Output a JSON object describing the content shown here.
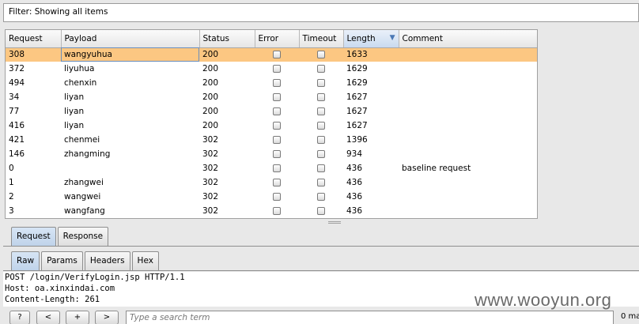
{
  "filter": {
    "label": "Filter:",
    "text": "Showing all items"
  },
  "table": {
    "columns": [
      "Request",
      "Payload",
      "Status",
      "Error",
      "Timeout",
      "Length",
      "Comment"
    ],
    "sorted_column": "Length",
    "sort_indicator": "▼",
    "rows": [
      {
        "request": "308",
        "payload": "wangyuhua",
        "status": "200",
        "error": false,
        "timeout": false,
        "length": "1633",
        "comment": ""
      },
      {
        "request": "372",
        "payload": "liyuhua",
        "status": "200",
        "error": false,
        "timeout": false,
        "length": "1629",
        "comment": ""
      },
      {
        "request": "494",
        "payload": "chenxin",
        "status": "200",
        "error": false,
        "timeout": false,
        "length": "1629",
        "comment": ""
      },
      {
        "request": "34",
        "payload": "liyan",
        "status": "200",
        "error": false,
        "timeout": false,
        "length": "1627",
        "comment": ""
      },
      {
        "request": "77",
        "payload": "liyan",
        "status": "200",
        "error": false,
        "timeout": false,
        "length": "1627",
        "comment": ""
      },
      {
        "request": "416",
        "payload": "liyan",
        "status": "200",
        "error": false,
        "timeout": false,
        "length": "1627",
        "comment": ""
      },
      {
        "request": "421",
        "payload": "chenmei",
        "status": "302",
        "error": false,
        "timeout": false,
        "length": "1396",
        "comment": ""
      },
      {
        "request": "146",
        "payload": "zhangming",
        "status": "302",
        "error": false,
        "timeout": false,
        "length": "934",
        "comment": ""
      },
      {
        "request": "0",
        "payload": "",
        "status": "302",
        "error": false,
        "timeout": false,
        "length": "436",
        "comment": "baseline request"
      },
      {
        "request": "1",
        "payload": "zhangwei",
        "status": "302",
        "error": false,
        "timeout": false,
        "length": "436",
        "comment": ""
      },
      {
        "request": "2",
        "payload": "wangwei",
        "status": "302",
        "error": false,
        "timeout": false,
        "length": "436",
        "comment": ""
      },
      {
        "request": "3",
        "payload": "wangfang",
        "status": "302",
        "error": false,
        "timeout": false,
        "length": "436",
        "comment": ""
      }
    ],
    "selected_row": 0,
    "selected_color": "#fcc782"
  },
  "top_tabs": {
    "items": [
      "Request",
      "Response"
    ],
    "active": 0
  },
  "sub_tabs": {
    "items": [
      "Raw",
      "Params",
      "Headers",
      "Hex"
    ],
    "active": 0
  },
  "request_lines": [
    "POST /login/VerifyLogin.jsp HTTP/1.1",
    "Host: oa.xinxindai.com",
    "Content-Length: 261"
  ],
  "watermark": "www.wooyun.org",
  "bottom": {
    "help": "?",
    "prev": "<",
    "add": "+",
    "next": ">",
    "search_placeholder": "Type a search term",
    "matches": "0 ma"
  }
}
